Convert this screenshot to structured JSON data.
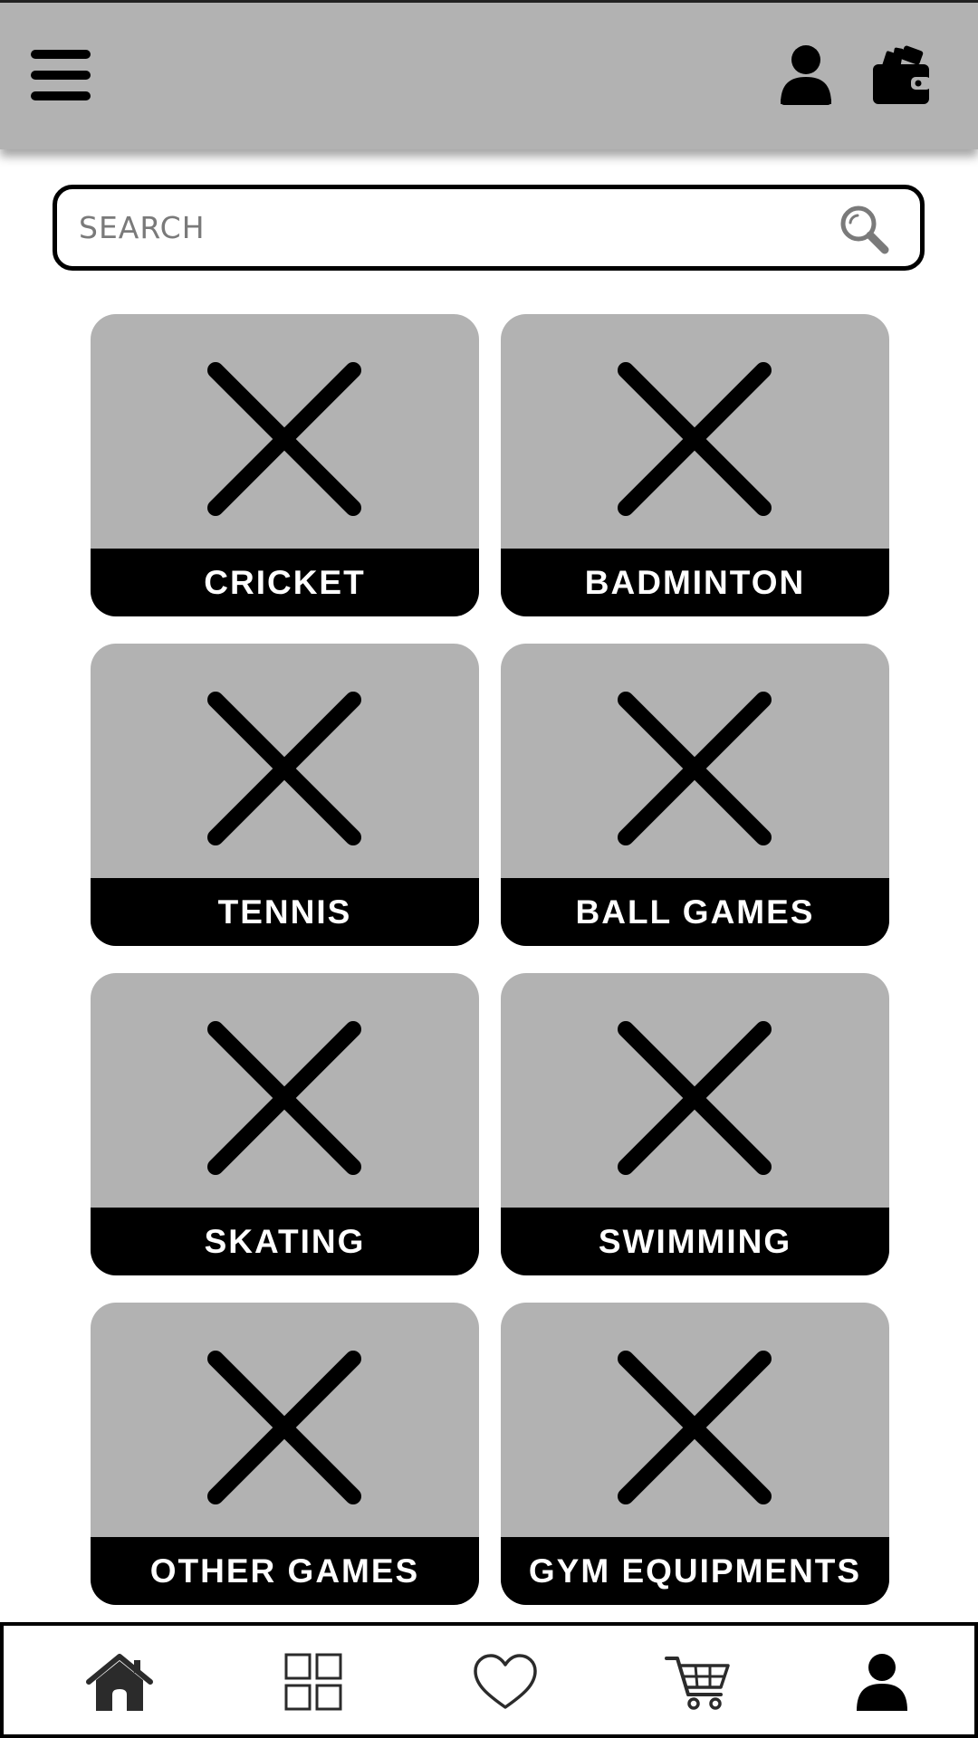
{
  "header": {
    "menu_icon": "hamburger-menu-icon",
    "profile_icon": "user-icon",
    "wallet_icon": "wallet-icon"
  },
  "search": {
    "placeholder": "SEARCH",
    "icon": "search-icon"
  },
  "categories": [
    {
      "label": "CRICKET",
      "icon": "image-placeholder-icon"
    },
    {
      "label": "BADMINTON",
      "icon": "image-placeholder-icon"
    },
    {
      "label": "TENNIS",
      "icon": "image-placeholder-icon"
    },
    {
      "label": "BALL GAMES",
      "icon": "image-placeholder-icon"
    },
    {
      "label": "SKATING",
      "icon": "image-placeholder-icon"
    },
    {
      "label": "SWIMMING",
      "icon": "image-placeholder-icon"
    },
    {
      "label": "OTHER GAMES",
      "icon": "image-placeholder-icon"
    },
    {
      "label": "GYM EQUIPMENTS",
      "icon": "image-placeholder-icon"
    }
  ],
  "bottom_nav": {
    "items": [
      {
        "icon": "home-icon"
      },
      {
        "icon": "grid-icon"
      },
      {
        "icon": "heart-icon"
      },
      {
        "icon": "cart-icon"
      },
      {
        "icon": "user-icon"
      }
    ]
  },
  "colors": {
    "header_bg": "#b2b2b2",
    "card_bg": "#b2b2b2",
    "label_bar": "#000000",
    "label_text": "#ffffff"
  }
}
